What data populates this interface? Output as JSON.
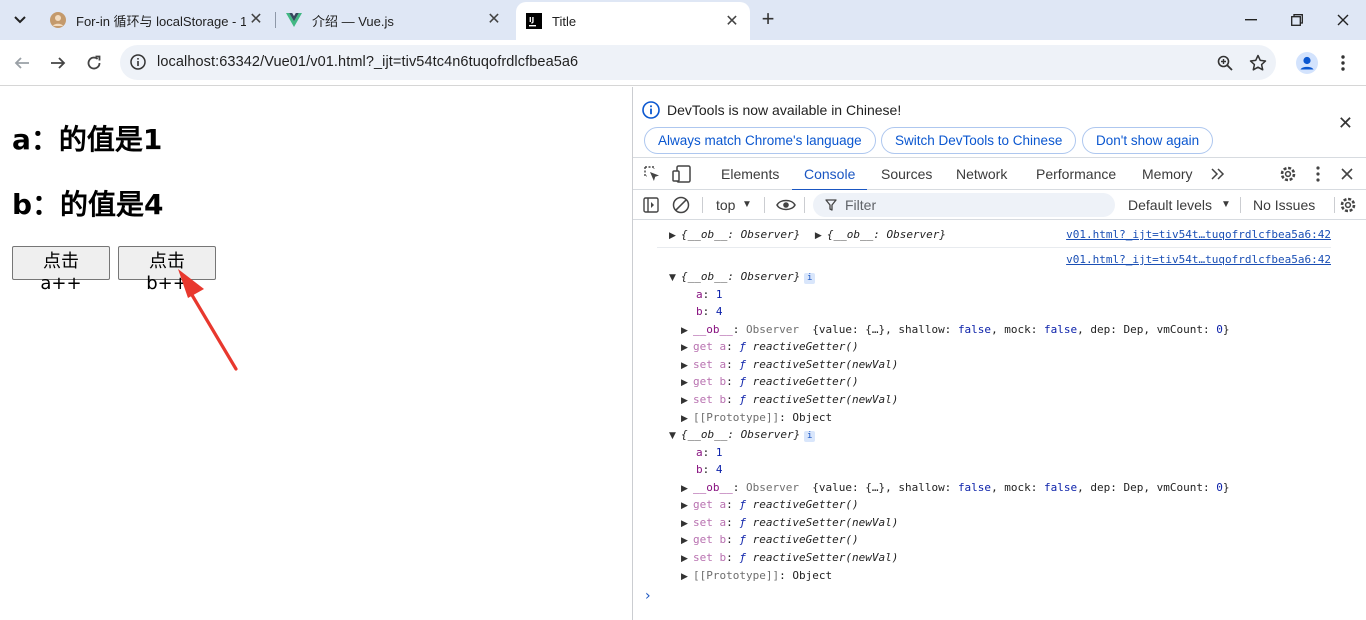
{
  "browser": {
    "tabs": [
      {
        "title": "For-in 循环与 localStorage - 1",
        "active": false
      },
      {
        "title": "介绍 — Vue.js",
        "active": false
      },
      {
        "title": "Title",
        "active": true
      }
    ],
    "url": "localhost:63342/Vue01/v01.html?_ijt=tiv54tc4n6tuqofrdlcfbea5a6"
  },
  "page": {
    "line_a": "a：的值是1",
    "line_b": "b：的值是4",
    "btn_a": "点击a++",
    "btn_b": "点击b++",
    "arrow_color": "#e8382e"
  },
  "devtools": {
    "infobar": {
      "message": "DevTools is now available in Chinese!",
      "btn_match": "Always match Chrome's language",
      "btn_switch": "Switch DevTools to Chinese",
      "btn_dont": "Don't show again"
    },
    "tabs": [
      "Elements",
      "Console",
      "Sources",
      "Network",
      "Performance",
      "Memory"
    ],
    "selected_tab": "Console",
    "console_bar": {
      "context": "top",
      "filter_placeholder": "Filter",
      "levels": "Default levels",
      "issues": "No Issues"
    },
    "source_link": "v01.html?_ijt=tiv54t…tuqofrdlcfbea5a6:42",
    "summary_obj": "{__ob__: Observer}",
    "props": {
      "a_key": "a",
      "a_val": "1",
      "b_key": "b",
      "b_val": "4",
      "ob_key": "__ob__",
      "ob_type": "Observer",
      "ob_preview_open": "{value: {…}, shallow: ",
      "false": "false",
      "mock": ", mock: ",
      "dep": ", dep: Dep, vmCount: ",
      "zero": "0",
      "close": "}",
      "get_a": "get a",
      "set_a": "set a",
      "get_b": "get b",
      "set_b": "set b",
      "getter": "reactiveGetter()",
      "setter": "reactiveSetter(newVal)",
      "f": "ƒ",
      "proto_key": "[[Prototype]]",
      "proto_val": "Object"
    }
  }
}
